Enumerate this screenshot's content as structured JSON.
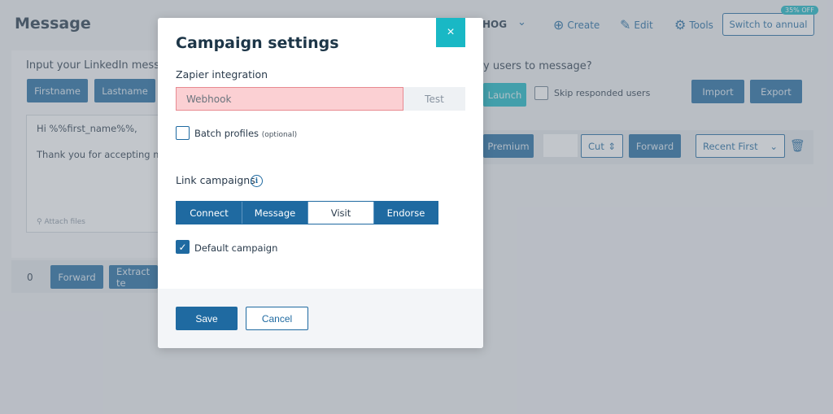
{
  "background": {
    "app_title": "Message",
    "account_name": "HOG",
    "nav": {
      "create": "Create",
      "edit": "Edit",
      "tools": "Tools",
      "switch_annual": "Switch to annual",
      "discount_badge": "35% OFF"
    },
    "left_panel": {
      "heading": "Input your LinkedIn mess",
      "tag_firstname": "Firstname",
      "tag_lastname": "Lastname",
      "message_line1": "Hi %%first_name%%,",
      "message_line2": "Thank you for accepting m",
      "attach_files": "Attach files"
    },
    "right_panel": {
      "heading": "y users to message?",
      "launch": "Launch",
      "skip_responded": "Skip responded users",
      "import": "Import",
      "export": "Export",
      "premium": "Premium",
      "cut": "Cut",
      "forward": "Forward",
      "sort": "Recent First"
    },
    "bottom_bar": {
      "count": "0",
      "forward": "Forward",
      "extract": "Extract te"
    }
  },
  "modal": {
    "title": "Campaign settings",
    "close_symbol": "×",
    "zapier_label": "Zapier integration",
    "webhook_placeholder": "Webhook",
    "test_label": "Test",
    "batch_label": "Batch profiles",
    "batch_optional": "(optional)",
    "batch_checked": false,
    "link_campaigns_label": "Link campaigns",
    "campaigns": [
      {
        "label": "Connect",
        "active": false
      },
      {
        "label": "Message",
        "active": false
      },
      {
        "label": "Visit",
        "active": true
      },
      {
        "label": "Endorse",
        "active": false
      }
    ],
    "default_campaign_label": "Default campaign",
    "default_campaign_checked": true,
    "save_label": "Save",
    "cancel_label": "Cancel"
  },
  "colors": {
    "primary": "#1f6aa1",
    "accent": "#19b8c5",
    "error_fill": "#fbd0d3"
  }
}
